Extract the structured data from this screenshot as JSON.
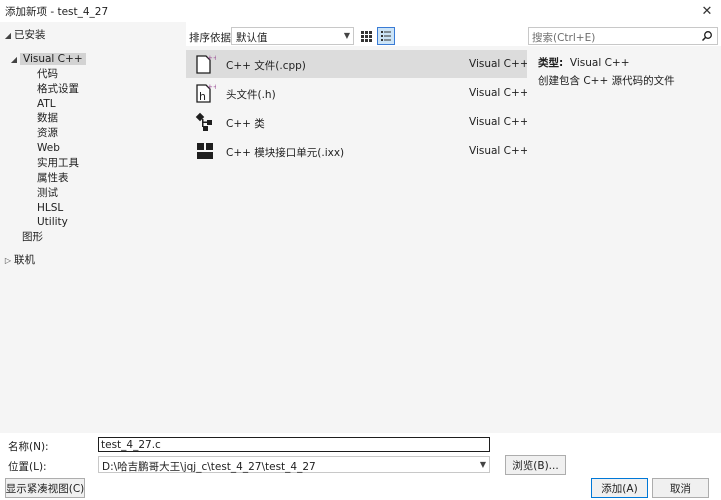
{
  "window": {
    "title": "添加新项 - test_4_27",
    "close_glyph": "✕"
  },
  "tree": {
    "installed": "已安装",
    "visual_cpp": "Visual C++",
    "children": [
      "代码",
      "格式设置",
      "ATL",
      "数据",
      "资源",
      "Web",
      "实用工具",
      "属性表",
      "测试",
      "HLSL",
      "Utility"
    ],
    "graphics": "图形",
    "online": "联机"
  },
  "toolbar": {
    "sort_label": "排序依据:",
    "sort_value": "默认值",
    "grid_icon": "grid-view-icon",
    "list_icon": "list-view-icon"
  },
  "search": {
    "placeholder": "搜索(Ctrl+E)",
    "icon": "search-icon"
  },
  "templates": [
    {
      "name": "C++ 文件(.cpp)",
      "lang": "Visual C++",
      "icon": "cpp-file-icon"
    },
    {
      "name": "头文件(.h)",
      "lang": "Visual C++",
      "icon": "header-file-icon"
    },
    {
      "name": "C++ 类",
      "lang": "Visual C++",
      "icon": "cpp-class-icon"
    },
    {
      "name": "C++ 模块接口单元(.ixx)",
      "lang": "Visual C++",
      "icon": "module-interface-icon"
    }
  ],
  "details": {
    "type_label": "类型:",
    "type_value": "Visual C++",
    "description": "创建包含 C++ 源代码的文件"
  },
  "form": {
    "name_label": "名称(N):",
    "name_value": "test_4_27.c",
    "location_label": "位置(L):",
    "location_value": "D:\\哈吉鹏哥大王\\jqj_c\\test_4_27\\test_4_27",
    "browse_label": "浏览(B)...",
    "compact_label": "显示紧凑视图(C)",
    "add_label": "添加(A)",
    "cancel_label": "取消"
  },
  "colors": {
    "accent": "#0078d7",
    "icon_plus": "#9b4f96",
    "selection": "#dcdcdc"
  }
}
